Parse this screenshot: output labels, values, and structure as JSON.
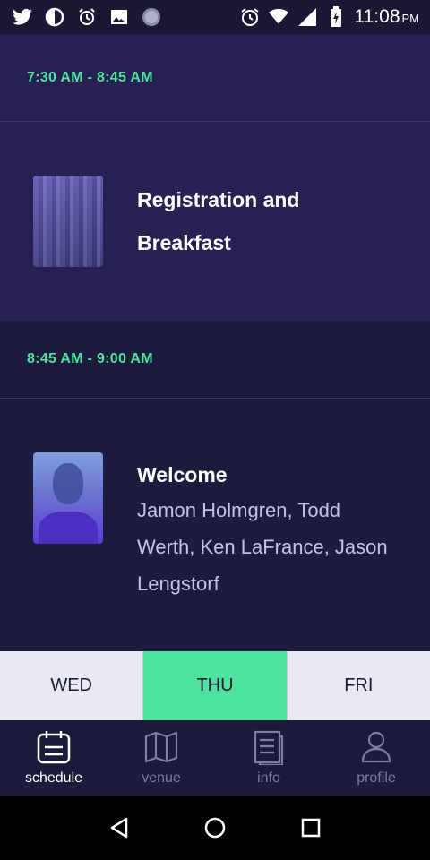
{
  "status_bar": {
    "time": "11:08",
    "ampm": "PM",
    "icons": [
      "twitter-icon",
      "contrast-icon",
      "alarm-icon",
      "image-icon",
      "circle-icon",
      "alarm-clock-icon",
      "wifi-icon",
      "signal-icon",
      "battery-icon"
    ]
  },
  "schedule": {
    "slots": [
      {
        "time": "7:30 AM - 8:45 AM",
        "title_line1": "Registration and",
        "title_line2": "Breakfast"
      },
      {
        "time": "8:45 AM - 9:00 AM",
        "title": "Welcome",
        "speakers_line1": "Jamon Holmgren, Todd",
        "speakers_line2": "Werth, Ken LaFrance, Jason",
        "speakers_line3": "Lengstorf"
      }
    ]
  },
  "day_tabs": {
    "items": [
      {
        "label": "WED",
        "active": false
      },
      {
        "label": "THU",
        "active": true
      },
      {
        "label": "FRI",
        "active": false
      }
    ]
  },
  "bottom_nav": {
    "items": [
      {
        "label": "schedule",
        "icon": "calendar-icon",
        "active": true
      },
      {
        "label": "venue",
        "icon": "map-icon",
        "active": false
      },
      {
        "label": "info",
        "icon": "document-icon",
        "active": false
      },
      {
        "label": "profile",
        "icon": "user-icon",
        "active": false
      }
    ]
  },
  "colors": {
    "accent": "#4fe3a0",
    "background": "#1c1b3d",
    "highlight_row": "#262152"
  }
}
